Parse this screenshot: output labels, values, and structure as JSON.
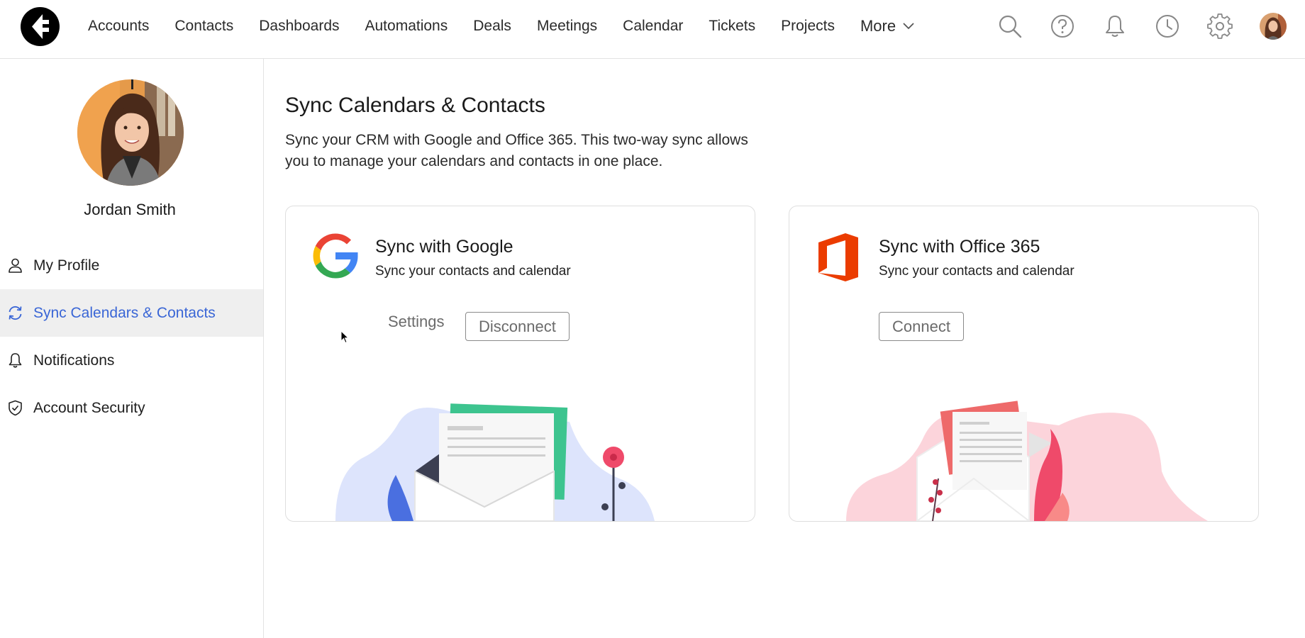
{
  "nav": {
    "items": [
      "Accounts",
      "Contacts",
      "Dashboards",
      "Automations",
      "Deals",
      "Meetings",
      "Calendar",
      "Tickets",
      "Projects"
    ],
    "more_label": "More",
    "icons": [
      "search-icon",
      "help-icon",
      "bell-icon",
      "clock-icon",
      "gear-icon"
    ]
  },
  "profile": {
    "name": "Jordan Smith"
  },
  "sidebar": {
    "items": [
      {
        "label": "My Profile",
        "icon": "user-icon",
        "active": false
      },
      {
        "label": "Sync Calendars & Contacts",
        "icon": "sync-icon",
        "active": true
      },
      {
        "label": "Notifications",
        "icon": "bell-icon",
        "active": false
      },
      {
        "label": "Account Security",
        "icon": "shield-icon",
        "active": false
      }
    ]
  },
  "main": {
    "title": "Sync Calendars & Contacts",
    "description_line1": "Sync your CRM with Google and Office 365. This two-way sync allows",
    "description_line2": "you to manage your calendars and contacts in one place."
  },
  "cards": {
    "google": {
      "title": "Sync with Google",
      "subtitle": "Sync your contacts and calendar",
      "settings_label": "Settings",
      "disconnect_label": "Disconnect"
    },
    "office": {
      "title": "Sync with Office 365",
      "subtitle": "Sync your contacts and calendar",
      "connect_label": "Connect"
    }
  },
  "colors": {
    "accent": "#3a66d6",
    "active_bg": "#efefef",
    "office_red": "#eb3c00",
    "google_blue": "#4285f4",
    "google_red": "#ea4335",
    "google_yellow": "#fbbc05",
    "google_green": "#34a853"
  }
}
